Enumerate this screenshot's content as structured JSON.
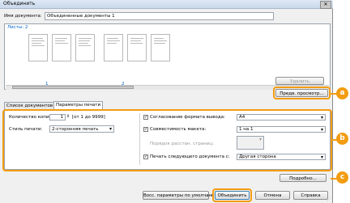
{
  "window": {
    "title": "Объединить",
    "close": "✕"
  },
  "doc_name": {
    "label": "Имя документа:",
    "value": "Объединенные документы 1"
  },
  "sheets": {
    "label": "Листы: 2",
    "page_numbers": [
      "1",
      "2"
    ]
  },
  "buttons": {
    "delete": "Удалить",
    "preview": "Предв. просмотр...",
    "details": "Подробно...",
    "restore_defaults": "Восс. параметры по умолчанию",
    "merge": "Объединить",
    "cancel": "Отмена",
    "help": "Справка"
  },
  "tabs": [
    "Список документов",
    "Параметры печати"
  ],
  "print_settings": {
    "copies_label": "Количество копий:",
    "copies_value": "1",
    "copies_range": "[от 1 до 9999]",
    "print_style_label": "Стиль печати:",
    "print_style_value": "2-сторонняя печать",
    "output_size_label": "Согласование формата вывода:",
    "output_size_value": "A4",
    "layout_label": "Совместимость макета:",
    "layout_value": "1 на 1",
    "page_order_label": "Порядок расстан. страниц:",
    "next_doc_label": "Печать следующего документа с:",
    "next_doc_value": "Другая сторона"
  },
  "callouts": [
    "a",
    "b",
    "c"
  ],
  "colors": {
    "accent": "#f39c12",
    "selection": "#0066cc"
  }
}
